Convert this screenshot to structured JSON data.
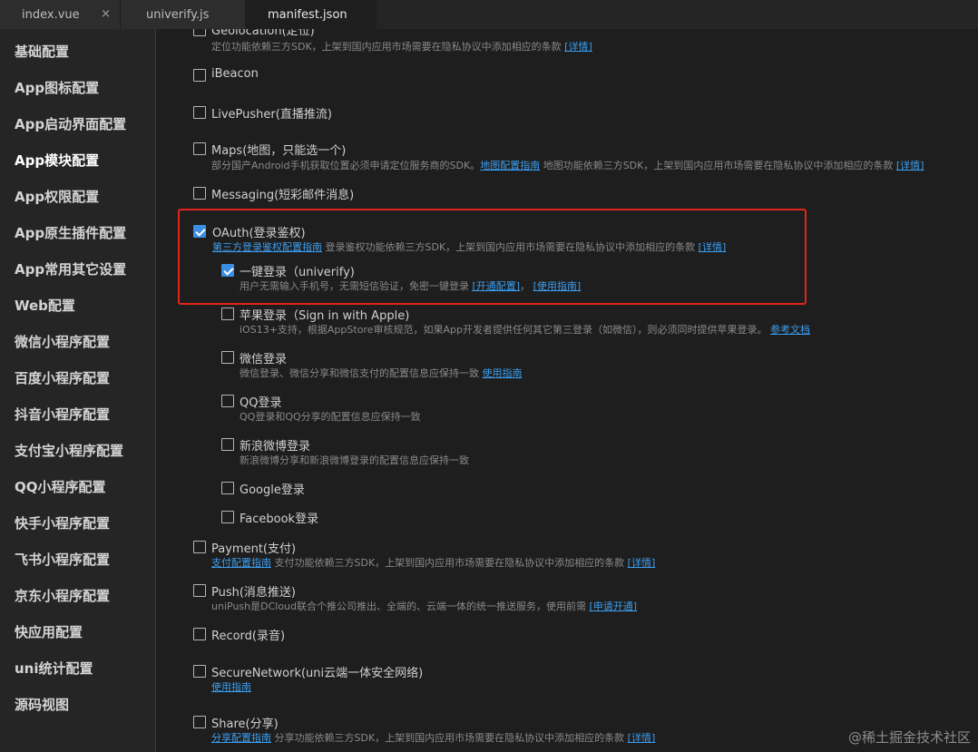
{
  "tabs": [
    {
      "label": "index.vue",
      "close": "×"
    },
    {
      "label": "univerify.js"
    },
    {
      "label": "manifest.json"
    }
  ],
  "sidebar": {
    "items": [
      "基础配置",
      "App图标配置",
      "App启动界面配置",
      "App模块配置",
      "App权限配置",
      "App原生插件配置",
      "App常用其它设置",
      "Web配置",
      "微信小程序配置",
      "百度小程序配置",
      "抖音小程序配置",
      "支付宝小程序配置",
      "QQ小程序配置",
      "快手小程序配置",
      "飞书小程序配置",
      "京东小程序配置",
      "快应用配置",
      "uni统计配置",
      "源码视图"
    ]
  },
  "modules": {
    "geolocation": {
      "title": "Geolocation(定位)",
      "desc": "定位功能依赖三方SDK，上架到国内应用市场需要在隐私协议中添加相应的条款",
      "link": "[详情]"
    },
    "ibeacon": {
      "title": "iBeacon"
    },
    "livepusher": {
      "title": "LivePusher(直播推流)"
    },
    "maps": {
      "title": "Maps(地图，只能选一个)",
      "desc1": "部分国产Android手机获取位置必须申请定位服务商的SDK。",
      "link1": "地图配置指南",
      "desc2": " 地图功能依赖三方SDK，上架到国内应用市场需要在隐私协议中添加相应的条款",
      "link2": "[详情]"
    },
    "messaging": {
      "title": "Messaging(短彩邮件消息)"
    },
    "oauth": {
      "title": "OAuth(登录鉴权)",
      "link1": "第三方登录鉴权配置指南",
      "desc": " 登录鉴权功能依赖三方SDK，上架到国内应用市场需要在隐私协议中添加相应的条款 ",
      "link2": "[详情]"
    },
    "univerify": {
      "title": "一键登录（univerify)",
      "desc": "用户无需输入手机号，无需短信验证，免密一键登录 ",
      "link1": "[开通配置]",
      "sep": "， ",
      "link2": "[使用指南]"
    },
    "apple": {
      "title": "苹果登录（Sign in with Apple)",
      "desc": "iOS13+支持，根据AppStore审核规范，如果App开发者提供任何其它第三登录（如微信），则必须同时提供苹果登录。 ",
      "link": "参考文档"
    },
    "weixin": {
      "title": "微信登录",
      "desc": "微信登录、微信分享和微信支付的配置信息应保持一致 ",
      "link": "使用指南"
    },
    "qq": {
      "title": "QQ登录",
      "desc": "QQ登录和QQ分享的配置信息应保持一致"
    },
    "sina": {
      "title": "新浪微博登录",
      "desc": "新浪微博分享和新浪微博登录的配置信息应保持一致"
    },
    "google": {
      "title": "Google登录"
    },
    "facebook": {
      "title": "Facebook登录"
    },
    "payment": {
      "title": "Payment(支付)",
      "link1": "支付配置指南",
      "desc": " 支付功能依赖三方SDK，上架到国内应用市场需要在隐私协议中添加相应的条款 ",
      "link2": "[详情]"
    },
    "push": {
      "title": "Push(消息推送)",
      "desc": "uniPush是DCloud联合个推公司推出、全端的、云端一体的统一推送服务，使用前需 ",
      "link": "[申请开通]"
    },
    "record": {
      "title": "Record(录音)"
    },
    "securenetwork": {
      "title": "SecureNetwork(uni云端一体安全网络)",
      "link": "使用指南"
    },
    "share": {
      "title": "Share(分享)",
      "link1": "分享配置指南",
      "desc": " 分享功能依赖三方SDK，上架到国内应用市场需要在隐私协议中添加相应的条款 ",
      "link2": "[详情]"
    }
  },
  "watermark": "@稀土掘金技术社区",
  "colors": {
    "accent": "#3a8ee6",
    "link": "#3c9ef0",
    "highlight": "#e0251b"
  }
}
